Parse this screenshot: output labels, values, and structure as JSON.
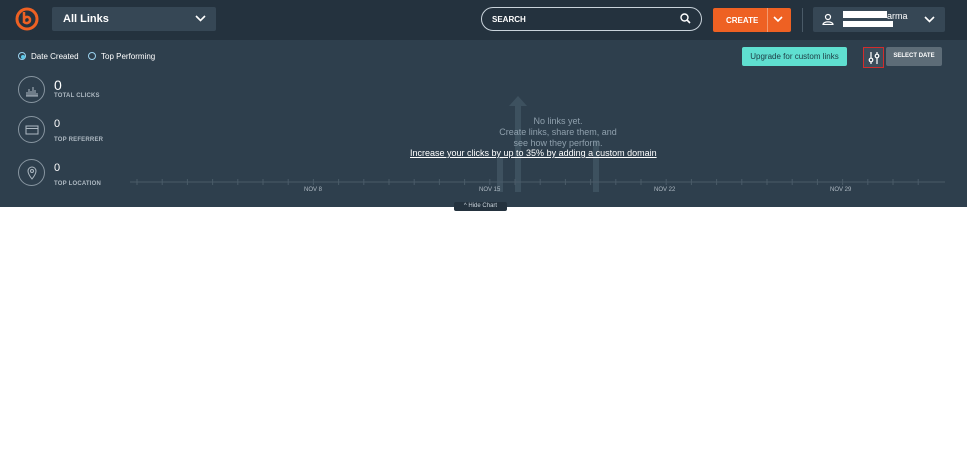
{
  "header": {
    "links_dropdown": "All Links",
    "search_placeholder": "SEARCH",
    "create_label": "CREATE",
    "user_name": "arma"
  },
  "filters": {
    "date_created": "Date Created",
    "top_performing": "Top Performing",
    "upgrade_label": "Upgrade for custom links",
    "select_date": "SELECT DATE"
  },
  "stats": [
    {
      "value": "0",
      "label": "TOTAL CLICKS",
      "icon": "bar-chart-icon"
    },
    {
      "value": "0",
      "label": "TOP REFERRER",
      "icon": "browser-window-icon"
    },
    {
      "value": "0",
      "label": "TOP LOCATION",
      "icon": "location-pin-icon"
    }
  ],
  "chart": {
    "empty_line1": "No links yet.",
    "empty_line2": "Create links, share them, and",
    "empty_line3": "see how they perform.",
    "domain_link": "Increase your clicks by up to 35% by adding a custom domain",
    "dates": [
      "NOV 8",
      "NOV 15",
      "NOV 22",
      "NOV 29"
    ],
    "hide_chart": "Hide Chart"
  },
  "colors": {
    "brand_orange": "#ee6123",
    "upgrade_teal": "#5fdfd0"
  }
}
